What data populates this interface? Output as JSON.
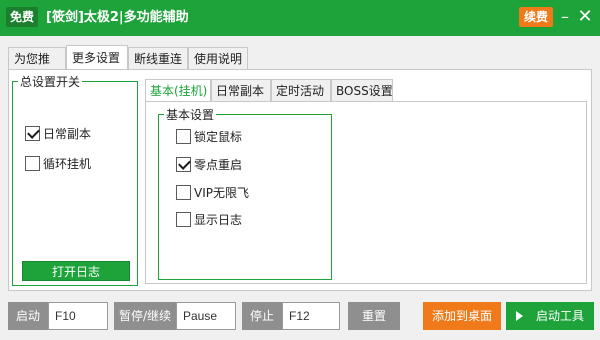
{
  "titlebar": {
    "free_badge": "免费",
    "title": "[筱剑]太极2|多功能辅助",
    "renew_label": "续费",
    "minimize_glyph": "–",
    "close_glyph": "✕"
  },
  "main_tabs": [
    {
      "label": "为您推荐",
      "active": false
    },
    {
      "label": "更多设置",
      "active": true
    },
    {
      "label": "断线重连",
      "active": false
    },
    {
      "label": "使用说明",
      "active": false
    }
  ],
  "general": {
    "group_label": "总设置开关",
    "items": [
      {
        "label": "日常副本",
        "checked": true
      },
      {
        "label": "循环挂机",
        "checked": false
      }
    ],
    "open_log_label": "打开日志"
  },
  "sub_tabs": [
    {
      "label": "基本(挂机)",
      "active": true
    },
    {
      "label": "日常副本",
      "active": false
    },
    {
      "label": "定时活动",
      "active": false
    },
    {
      "label": "BOSS设置",
      "active": false
    }
  ],
  "basic": {
    "group_label": "基本设置",
    "items": [
      {
        "label": "锁定鼠标",
        "checked": false
      },
      {
        "label": "零点重启",
        "checked": true
      },
      {
        "label": "VIP无限飞",
        "checked": false
      },
      {
        "label": "显示日志",
        "checked": false
      }
    ]
  },
  "controls": {
    "start_label": "启动",
    "start_hotkey": "F10",
    "pause_label": "暂停/继续",
    "pause_hotkey": "Pause",
    "stop_label": "停止",
    "stop_hotkey": "F12",
    "reset_label": "重置",
    "add_desktop_label": "添加到桌面",
    "start_tool_label": "启动工具"
  },
  "colors": {
    "accent_green": "#1ea33b",
    "accent_orange": "#f07a1a",
    "control_gray": "#8f8f8f"
  }
}
